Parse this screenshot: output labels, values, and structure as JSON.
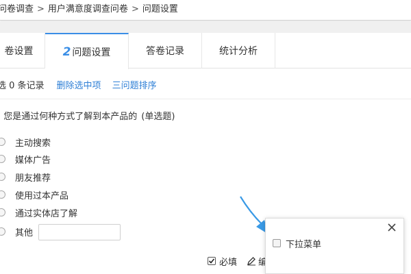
{
  "breadcrumb": {
    "items": [
      "问卷调查",
      "用户满意度调查问卷",
      "问题设置"
    ],
    "separator": ">"
  },
  "tabs": [
    {
      "label": "卷设置"
    },
    {
      "number": "2",
      "label": "问题设置",
      "active": true
    },
    {
      "label": "答卷记录"
    },
    {
      "label": "统计分析"
    }
  ],
  "actions": {
    "selected_count": "选 0 条记录",
    "delete_label": "删除选中项",
    "sort_label": "三问题排序"
  },
  "question": {
    "text": ". 您是通过何种方式了解到本产品的",
    "type": "(单选题)",
    "options": [
      "主动搜索",
      "媒体广告",
      "朋友推荐",
      "使用过本产品",
      "通过实体店了解",
      "其他"
    ],
    "other_input_value": ""
  },
  "toolbar": {
    "required_label": "必填",
    "required_checked": true,
    "edit_label": "编"
  },
  "popup": {
    "dropdown_label": "下拉菜单",
    "dropdown_checked": false
  },
  "colors": {
    "accent": "#3a8ee6",
    "link": "#2e7fd6",
    "arrow": "#3a9ae6"
  }
}
